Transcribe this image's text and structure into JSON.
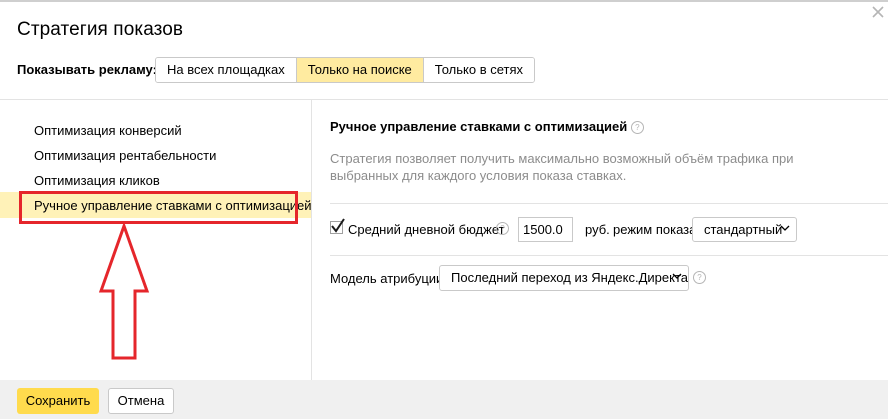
{
  "dialog": {
    "title": "Стратегия показов",
    "close_icon": "close-icon"
  },
  "show_ads": {
    "label": "Показывать рекламу:",
    "options": [
      "На всех площадках",
      "Только на поиске",
      "Только в сетях"
    ],
    "selected": "Только на поиске"
  },
  "strategies": {
    "items": [
      "Оптимизация конверсий",
      "Оптимизация рентабельности",
      "Оптимизация кликов",
      "Ручное управление ставками с оптимизацией"
    ],
    "selected": "Ручное управление ставками с оптимизацией"
  },
  "details": {
    "title": "Ручное управление ставками с оптимизацией",
    "description": "Стратегия позволяет получить максимально возможный объём трафика при выбранных для каждого условия показа ставках.",
    "budget": {
      "checked": true,
      "label": "Средний дневной бюджет",
      "value": "1500.0",
      "currency": "руб.",
      "mode_label": "режим показа",
      "mode_value": "стандартный"
    },
    "attribution": {
      "label": "Модель атрибуции:",
      "value": "Последний переход из Яндекс.Директа"
    },
    "help_glyph": "?"
  },
  "footer": {
    "save_label": "Сохранить",
    "cancel_label": "Отмена"
  },
  "colors": {
    "accent_yellow": "#ffdb4d",
    "selected_tab": "#ffeba0",
    "selected_item": "#fff2b8",
    "annotation_red": "#e5262b"
  }
}
